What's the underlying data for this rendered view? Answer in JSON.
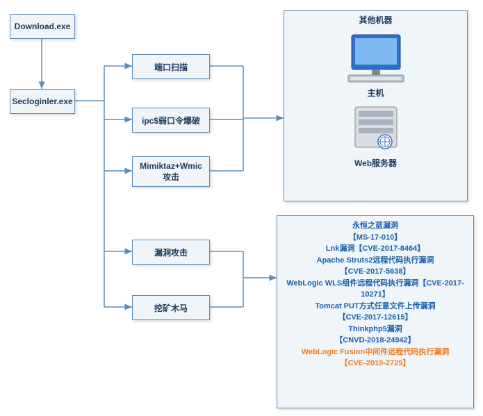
{
  "nodes": {
    "download": "Download.exe",
    "secloginler": "Secloginler.exe",
    "port_scan": "端口扫描",
    "ipc_brute": "ipc$弱口令爆破",
    "mimikatz": "Mimiktaz+Wmic\n攻击",
    "vuln_attack": "漏洞攻击",
    "mining_trojan": "挖矿木马"
  },
  "network_box": {
    "title": "其他机器",
    "host_label": "主机",
    "web_label": "Web服务器"
  },
  "vulnerabilities": {
    "lines": [
      "永恒之蓝漏洞",
      "【MS-17-010】",
      "Lnk漏洞【CVE-2017-8464】",
      "Apache Struts2远程代码执行漏洞",
      "【CVE-2017-5638】",
      "WebLogic WLS组件远程代码执行漏洞【CVE-2017-10271】",
      "Tomcat PUT方式任意文件上传漏洞",
      "【CVE-2017-12615】",
      "Thinkphp5漏洞",
      "【CNVD-2018-24942】"
    ],
    "orange_lines": [
      "WebLogic Fusion中间件远程代码执行漏洞",
      "【CVE-2019-2725】"
    ]
  }
}
